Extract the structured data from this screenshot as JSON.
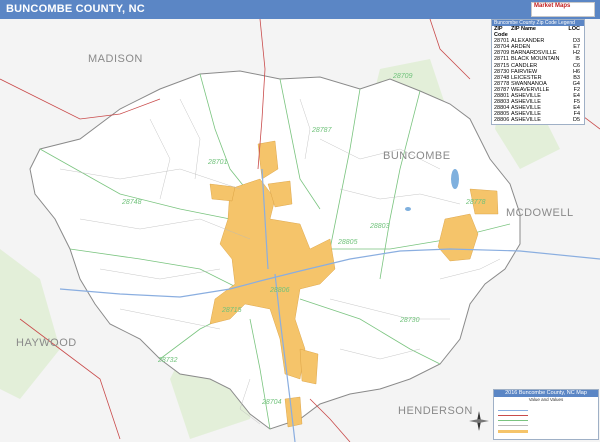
{
  "header": {
    "title": "BUNCOMBE COUNTY, NC",
    "logo_text": "Market Maps"
  },
  "counties": [
    {
      "name": "MADISON"
    },
    {
      "name": "BUNCOMBE"
    },
    {
      "name": "MCDOWELL"
    },
    {
      "name": "HAYWOOD"
    },
    {
      "name": "HENDERSON"
    }
  ],
  "zip_labels": [
    "28709",
    "28787",
    "28701",
    "28748",
    "28805",
    "28803",
    "28806",
    "28715",
    "28704",
    "28732",
    "28730",
    "28778"
  ],
  "legend": {
    "heading": "Buncombe County Zip Code Legend",
    "columns": [
      "ZIP Code",
      "ZIP Name",
      "LOC"
    ],
    "rows": [
      [
        "28701",
        "ALEXANDER",
        "D3"
      ],
      [
        "28704",
        "ARDEN",
        "E7"
      ],
      [
        "28709",
        "BARNARDSVILLE",
        "H2"
      ],
      [
        "28711",
        "BLACK MOUNTAIN",
        "I5"
      ],
      [
        "28715",
        "CANDLER",
        "C6"
      ],
      [
        "28730",
        "FAIRVIEW",
        "H6"
      ],
      [
        "28748",
        "LEICESTER",
        "B3"
      ],
      [
        "28778",
        "SWANNANOA",
        "G4"
      ],
      [
        "28787",
        "WEAVERVILLE",
        "F2"
      ],
      [
        "28801",
        "ASHEVILLE",
        "E4"
      ],
      [
        "28803",
        "ASHEVILLE",
        "F5"
      ],
      [
        "28804",
        "ASHEVILLE",
        "E4"
      ],
      [
        "28805",
        "ASHEVILLE",
        "F4"
      ],
      [
        "28806",
        "ASHEVILLE",
        "D5"
      ]
    ]
  },
  "inset": {
    "title": "2016 Buncombe County, NC Map",
    "subtitle": "Value and Values"
  },
  "colors": {
    "title_bar": "#5b86c5",
    "urban": "#f5c46a",
    "county_fill": "#ffffff",
    "outside": "#f3f3f3",
    "zip_line": "#7ac47f",
    "highway": "#c94b4b",
    "water": "#7fb0de"
  }
}
